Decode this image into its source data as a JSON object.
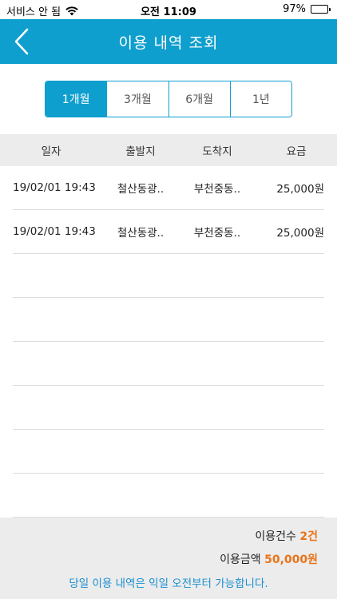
{
  "status_bar": {
    "carrier": "서비스 안 됨",
    "time": "오전 11:09",
    "battery": "97%"
  },
  "header": {
    "title": "이용 내역 조회"
  },
  "tabs": [
    {
      "label": "1개월",
      "active": true
    },
    {
      "label": "3개월",
      "active": false
    },
    {
      "label": "6개월",
      "active": false
    },
    {
      "label": "1년",
      "active": false
    }
  ],
  "table": {
    "columns": [
      "일자",
      "출발지",
      "도착지",
      "요금"
    ],
    "rows": [
      {
        "date": "19/02/01 19:43",
        "from": "철산동광..",
        "to": "부천중동..",
        "fare": "25,000원"
      },
      {
        "date": "19/02/01 19:43",
        "from": "철산동광..",
        "to": "부천중동..",
        "fare": "25,000원"
      }
    ]
  },
  "summary": {
    "count_label": "이용건수",
    "count_value": "2건",
    "amount_label": "이용금액",
    "amount_value": "50,000원",
    "notice": "당일 이용 내역은 익일 오전부터 가능합니다."
  },
  "colors": {
    "accent": "#0f9fce",
    "highlight": "#e8741a",
    "notice": "#1a8fd0"
  }
}
